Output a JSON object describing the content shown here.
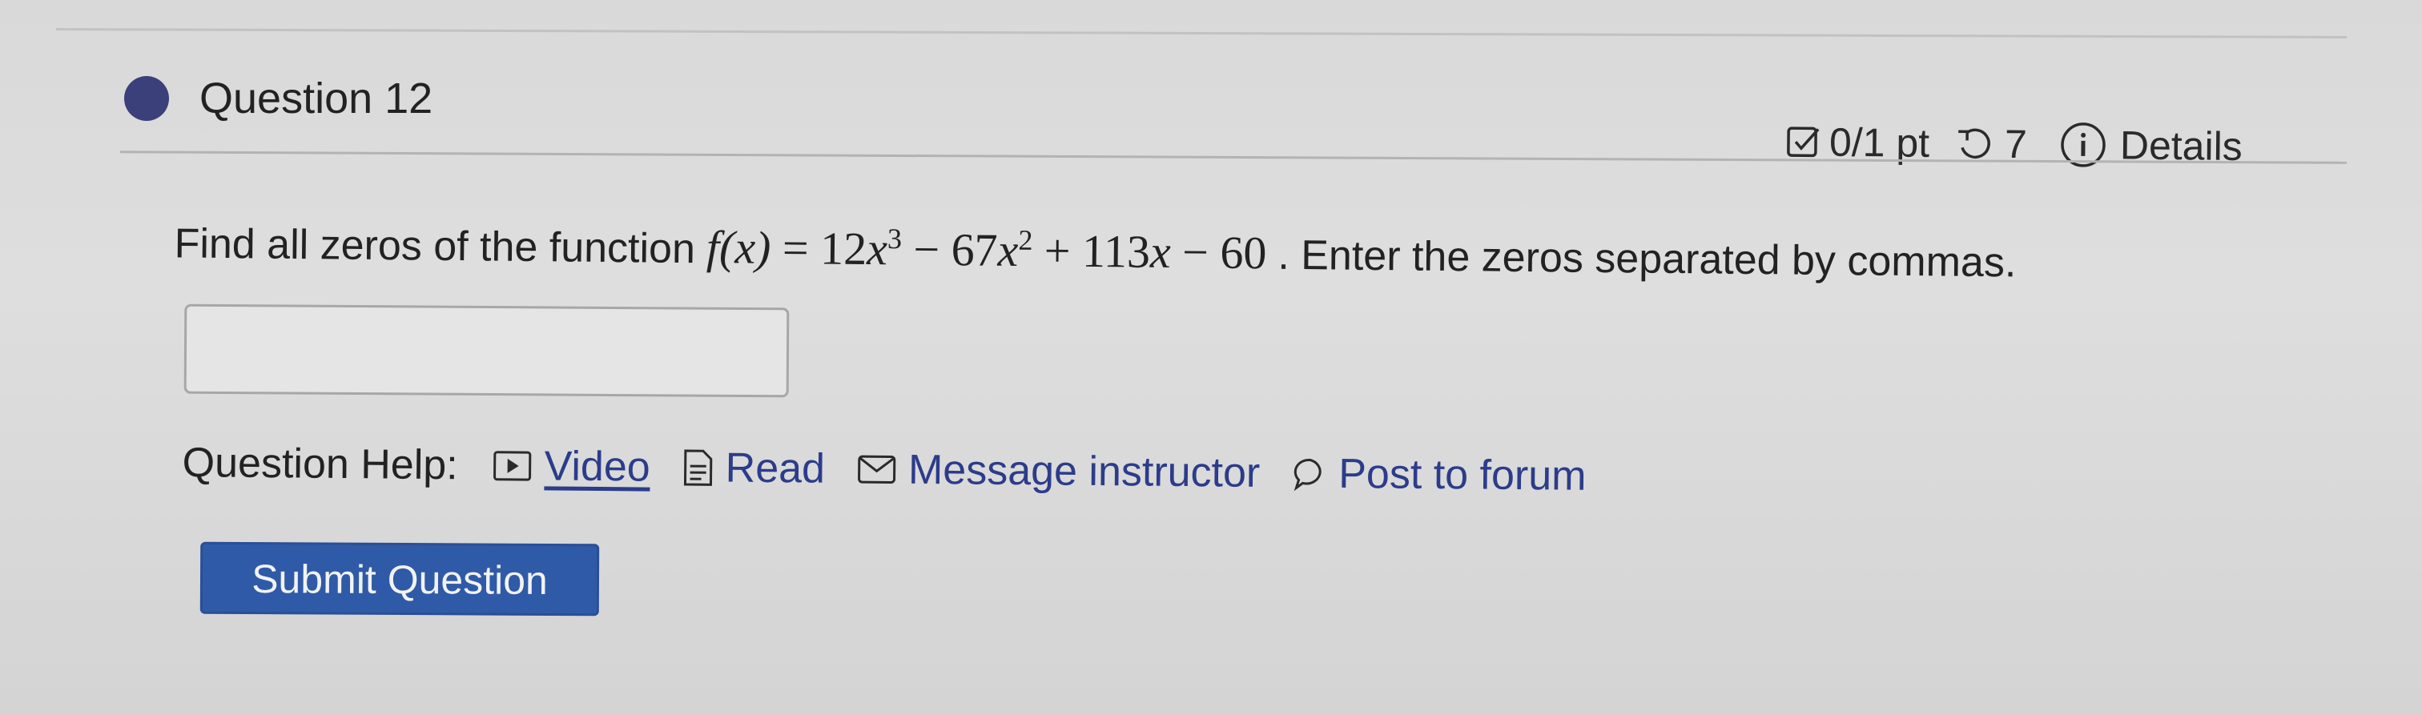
{
  "question": {
    "title": "Question 12",
    "status_color": "#3b3f7a"
  },
  "meta": {
    "score": "0/1 pt",
    "attempts": "7",
    "details_label": "Details"
  },
  "prompt": {
    "lead": "Find all zeros of the function",
    "fx": "f(x)",
    "equals": "=",
    "c1": "12",
    "exp1": "3",
    "minus1": "−",
    "c2": "67",
    "exp2": "2",
    "plus": "+",
    "c3": "113",
    "minus2": "−",
    "c4": "60",
    "var": "x",
    "tail": ". Enter the zeros separated by commas."
  },
  "answer": {
    "value": "",
    "placeholder": ""
  },
  "help": {
    "label": "Question Help:",
    "video": "Video",
    "read": "Read",
    "message": "Message instructor",
    "forum": "Post to forum",
    "link_color": "#2c3c8a"
  },
  "submit": {
    "label": "Submit Question",
    "color": "#2f5aa7"
  }
}
